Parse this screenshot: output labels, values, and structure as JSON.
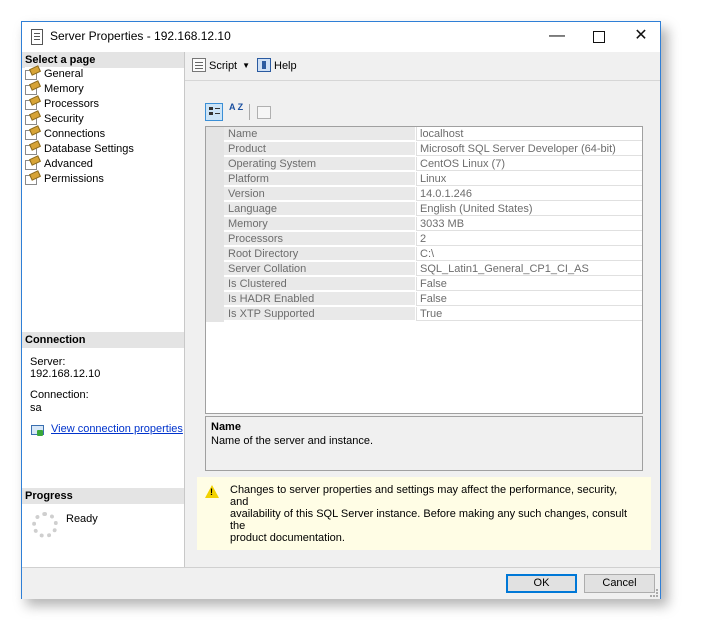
{
  "window": {
    "title": "Server Properties - 192.168.12.10"
  },
  "title_controls": {
    "minimize": "—",
    "close": "✕"
  },
  "left_pane": {
    "select_page_header": "Select a page",
    "pages": [
      {
        "label": "General"
      },
      {
        "label": "Memory"
      },
      {
        "label": "Processors"
      },
      {
        "label": "Security"
      },
      {
        "label": "Connections"
      },
      {
        "label": "Database Settings"
      },
      {
        "label": "Advanced"
      },
      {
        "label": "Permissions"
      }
    ],
    "connection_header": "Connection",
    "server_label": "Server:",
    "server_value": "192.168.12.10",
    "connection_label": "Connection:",
    "connection_value": "sa",
    "view_link": "View connection properties",
    "progress_header": "Progress",
    "progress_status": "Ready"
  },
  "toolbar": {
    "script_label": "Script",
    "help_label": "Help"
  },
  "property_grid": {
    "alpha_icon_text": "A Z",
    "rows": [
      {
        "name": "Name",
        "value": "localhost"
      },
      {
        "name": "Product",
        "value": "Microsoft SQL Server Developer (64-bit)"
      },
      {
        "name": "Operating System",
        "value": "CentOS Linux (7)"
      },
      {
        "name": "Platform",
        "value": "Linux"
      },
      {
        "name": "Version",
        "value": "14.0.1.246"
      },
      {
        "name": "Language",
        "value": "English (United States)"
      },
      {
        "name": "Memory",
        "value": "3033 MB"
      },
      {
        "name": "Processors",
        "value": "2"
      },
      {
        "name": "Root Directory",
        "value": "C:\\"
      },
      {
        "name": "Server Collation",
        "value": "SQL_Latin1_General_CP1_CI_AS"
      },
      {
        "name": "Is Clustered",
        "value": "False"
      },
      {
        "name": "Is HADR Enabled",
        "value": "False"
      },
      {
        "name": "Is XTP Supported",
        "value": "True"
      }
    ]
  },
  "description": {
    "title": "Name",
    "text": "Name of the server and instance."
  },
  "warning": {
    "line1": "Changes to server properties and settings may affect the performance, security, and",
    "line2": "availability of this SQL Server instance. Before making any such changes, consult the",
    "line3": "product documentation."
  },
  "footer": {
    "ok_label": "OK",
    "cancel_label": "Cancel"
  },
  "colors": {
    "accent": "#0078d7",
    "link": "#0033cc",
    "warning_bg": "#fffde5"
  }
}
